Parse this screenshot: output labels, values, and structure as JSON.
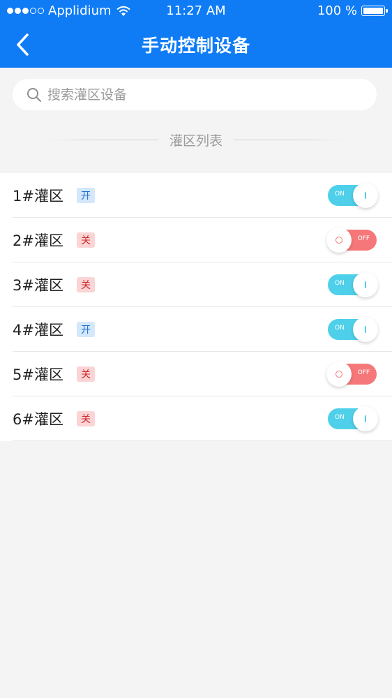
{
  "status_bar": {
    "carrier": "Applidium",
    "time": "11:27 AM",
    "battery": "100 %"
  },
  "header": {
    "title": "手动控制设备",
    "back_icon": "chevron-left-icon"
  },
  "search": {
    "placeholder": "搜索灌区设备",
    "value": "",
    "icon": "search-icon"
  },
  "section": {
    "label": "灌区列表"
  },
  "zones": [
    {
      "name": "1#灌区",
      "status": "开",
      "switch": "ON",
      "on": true
    },
    {
      "name": "2#灌区",
      "status": "关",
      "switch": "OFF",
      "on": false
    },
    {
      "name": "3#灌区",
      "status": "关",
      "switch": "ON",
      "on": true
    },
    {
      "name": "4#灌区",
      "status": "开",
      "switch": "ON",
      "on": true
    },
    {
      "name": "5#灌区",
      "status": "关",
      "switch": "OFF",
      "on": false
    },
    {
      "name": "6#灌区",
      "status": "关",
      "switch": "ON",
      "on": true
    }
  ],
  "colors": {
    "header_bg": "#0f7cf6",
    "toggle_on": "#4fd0ea",
    "toggle_off": "#f6777a",
    "badge_on_bg": "#d4e7fb",
    "badge_off_bg": "#fbd5d5"
  }
}
